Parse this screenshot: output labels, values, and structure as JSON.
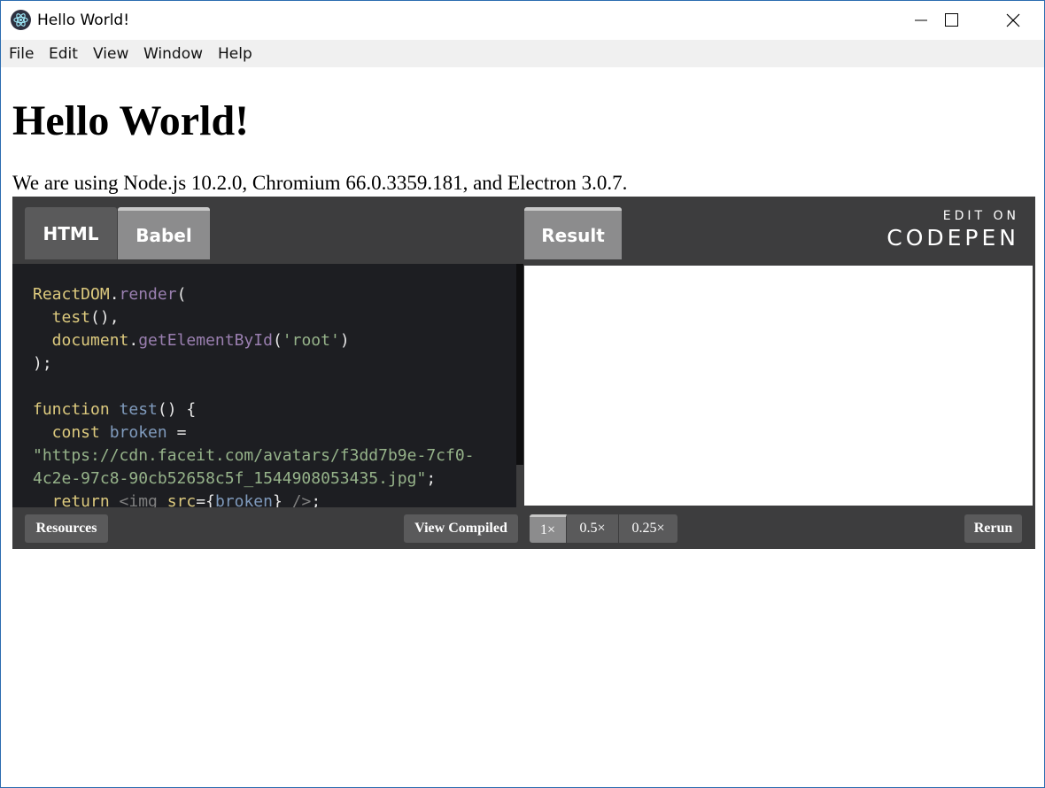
{
  "window": {
    "title": "Hello World!",
    "controls": [
      "minimize",
      "maximize",
      "close"
    ]
  },
  "menu": [
    "File",
    "Edit",
    "View",
    "Window",
    "Help"
  ],
  "page": {
    "heading": "Hello World!",
    "text": "We are using Node.js 10.2.0, Chromium 66.0.3359.181, and Electron 3.0.7."
  },
  "codepen": {
    "tabs": [
      "HTML",
      "Babel"
    ],
    "result_tab": "Result",
    "edit_on": "EDIT ON",
    "logo": "CODEPEN",
    "code_lines": [
      [
        {
          "t": "ReactDOM",
          "c": "tk-kw"
        },
        {
          "t": ".",
          "c": "tk-punct"
        },
        {
          "t": "render",
          "c": "tk-prop"
        },
        {
          "t": "(",
          "c": "tk-punct"
        }
      ],
      [
        {
          "t": "  test",
          "c": "tk-kw"
        },
        {
          "t": "(),",
          "c": "tk-punct"
        }
      ],
      [
        {
          "t": "  document",
          "c": "tk-kw"
        },
        {
          "t": ".",
          "c": "tk-punct"
        },
        {
          "t": "getElementById",
          "c": "tk-prop"
        },
        {
          "t": "(",
          "c": "tk-punct"
        },
        {
          "t": "'root'",
          "c": "tk-str"
        },
        {
          "t": ")",
          "c": "tk-punct"
        }
      ],
      [
        {
          "t": ");",
          "c": "tk-punct"
        }
      ],
      [],
      [
        {
          "t": "function ",
          "c": "tk-kw"
        },
        {
          "t": "test",
          "c": "tk-call"
        },
        {
          "t": "() {",
          "c": "tk-punct"
        }
      ],
      [
        {
          "t": "  const ",
          "c": "tk-kw"
        },
        {
          "t": "broken",
          "c": "tk-call"
        },
        {
          "t": " =",
          "c": "tk-punct"
        }
      ],
      [
        {
          "t": "\"https://cdn.faceit.com/avatars/f3dd7b9e-7cf0-",
          "c": "tk-str"
        }
      ],
      [
        {
          "t": "4c2e-97c8-90cb52658c5f_1544908053435.jpg\"",
          "c": "tk-str"
        },
        {
          "t": ";",
          "c": "tk-punct"
        }
      ],
      [
        {
          "t": "  return ",
          "c": "tk-kw"
        },
        {
          "t": "<img ",
          "c": "tk-tag"
        },
        {
          "t": "src",
          "c": "tk-kw"
        },
        {
          "t": "={",
          "c": "tk-punct"
        },
        {
          "t": "broken",
          "c": "tk-call"
        },
        {
          "t": "} ",
          "c": "tk-punct"
        },
        {
          "t": "/>",
          "c": "tk-tag"
        },
        {
          "t": ";",
          "c": "tk-punct"
        }
      ]
    ],
    "footer": {
      "resources": "Resources",
      "view_compiled": "View Compiled",
      "zoom": [
        "1×",
        "0.5×",
        "0.25×"
      ],
      "zoom_active": "1×",
      "rerun": "Rerun"
    }
  }
}
